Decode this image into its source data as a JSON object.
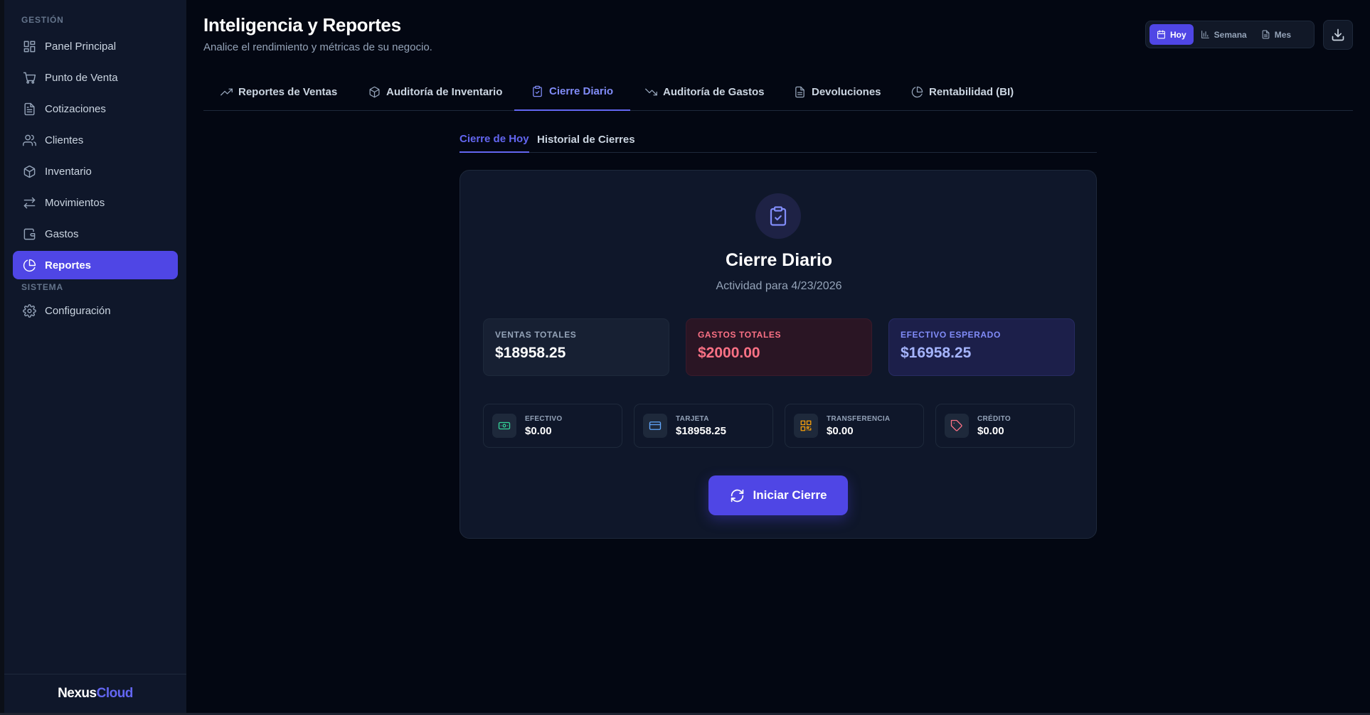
{
  "sidebar": {
    "section_management": "GESTIÓN",
    "section_system": "SISTEMA",
    "items": [
      {
        "label": "Panel Principal",
        "icon": "dashboard-icon"
      },
      {
        "label": "Punto de Venta",
        "icon": "cart-icon"
      },
      {
        "label": "Cotizaciones",
        "icon": "document-icon"
      },
      {
        "label": "Clientes",
        "icon": "users-icon"
      },
      {
        "label": "Inventario",
        "icon": "box-icon"
      },
      {
        "label": "Movimientos",
        "icon": "arrows-icon"
      },
      {
        "label": "Gastos",
        "icon": "wallet-icon"
      },
      {
        "label": "Reportes",
        "icon": "pie-chart-icon",
        "active": true
      }
    ],
    "system_items": [
      {
        "label": "Configuración",
        "icon": "gear-icon"
      }
    ],
    "logo": {
      "part1": "Nexus",
      "part2": "Cloud"
    }
  },
  "header": {
    "title": "Inteligencia y Reportes",
    "subtitle": "Analice el rendimiento y métricas de su negocio."
  },
  "period": {
    "options": [
      "Hoy",
      "Semana",
      "Mes"
    ],
    "selected": "Hoy"
  },
  "tabs": [
    {
      "label": "Reportes de Ventas",
      "icon": "trending-up-icon"
    },
    {
      "label": "Auditoría de Inventario",
      "icon": "box-icon"
    },
    {
      "label": "Cierre Diario",
      "icon": "clipboard-check-icon",
      "active": true
    },
    {
      "label": "Auditoría de Gastos",
      "icon": "trending-down-icon"
    },
    {
      "label": "Devoluciones",
      "icon": "document-icon"
    },
    {
      "label": "Rentabilidad (BI)",
      "icon": "pie-chart-icon"
    }
  ],
  "subtabs": [
    {
      "label": "Cierre de Hoy",
      "active": true
    },
    {
      "label": "Historial de Cierres"
    }
  ],
  "closing": {
    "title": "Cierre Diario",
    "subtitle": "Actividad para 4/23/2026",
    "stats": {
      "sales": {
        "label": "VENTAS TOTALES",
        "value": "$18958.25"
      },
      "expenses": {
        "label": "GASTOS TOTALES",
        "value": "$2000.00"
      },
      "expected_cash": {
        "label": "EFECTIVO ESPERADO",
        "value": "$16958.25"
      }
    },
    "payments": [
      {
        "label": "EFECTIVO",
        "value": "$0.00",
        "icon": "cash-icon",
        "color": "#34d399"
      },
      {
        "label": "TARJETA",
        "value": "$18958.25",
        "icon": "credit-card-icon",
        "color": "#60a5fa"
      },
      {
        "label": "TRANSFERENCIA",
        "value": "$0.00",
        "icon": "qr-code-icon",
        "color": "#f59e0b"
      },
      {
        "label": "CRÉDITO",
        "value": "$0.00",
        "icon": "tag-icon",
        "color": "#fb7185"
      }
    ],
    "action_label": "Iniciar Cierre"
  },
  "colors": {
    "accent": "#4f46e5",
    "background": "#030712",
    "sidebar": "#0f172a"
  }
}
